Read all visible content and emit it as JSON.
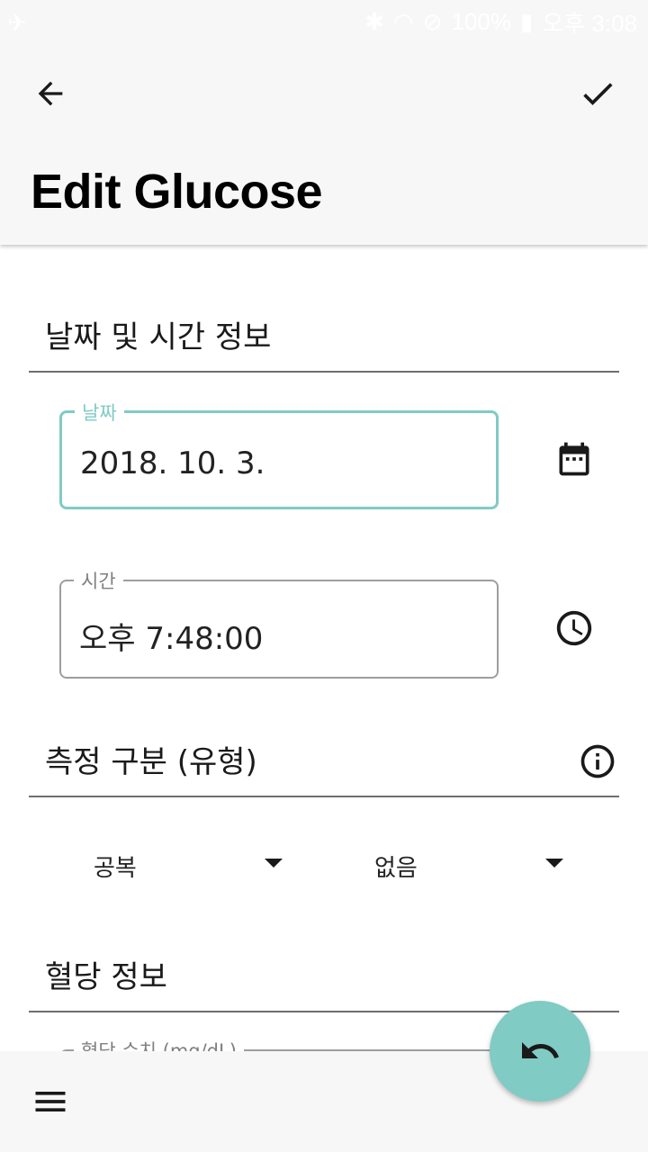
{
  "status_bar": {
    "battery": "100%",
    "clock": "오후 3:08"
  },
  "app_bar": {
    "title": "Edit Glucose",
    "back_icon": "arrow-left-icon",
    "confirm_icon": "check-icon"
  },
  "sections": {
    "datetime": {
      "label": "날짜 및 시간 정보"
    },
    "measurement": {
      "label": "측정 구분 (유형)"
    },
    "glucose": {
      "label": "혈당 정보"
    }
  },
  "fields": {
    "date": {
      "label": "날짜",
      "value": "2018. 10. 3."
    },
    "time": {
      "label": "시간",
      "value": "오후 7:48:00"
    },
    "glucose_value": {
      "label": "혈당 수치 (mg/dL)"
    }
  },
  "dropdowns": {
    "meal_state": {
      "selected": "공복"
    },
    "extra": {
      "selected": "없음"
    }
  },
  "colors": {
    "accent": "#80cbc4",
    "app_bar_bg": "#f7f7f7",
    "divider": "#6e6e6e"
  }
}
